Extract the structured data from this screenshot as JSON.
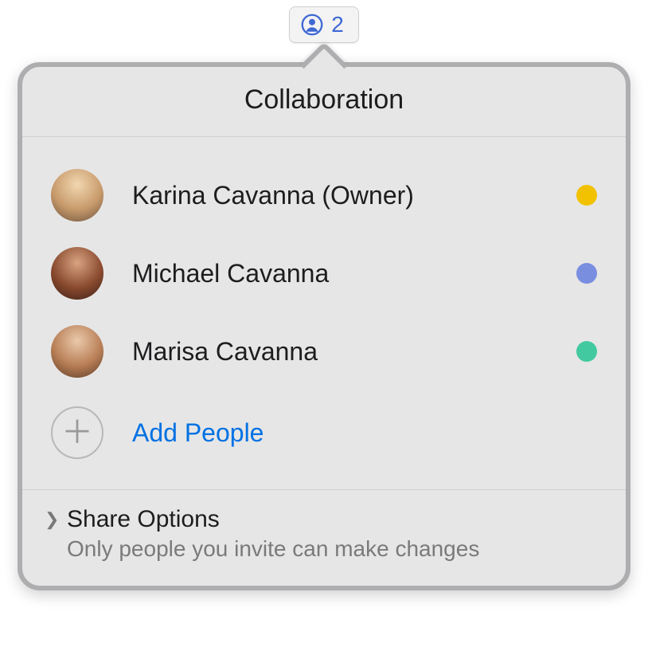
{
  "trigger": {
    "count": "2",
    "icon_color": "#3e68d4"
  },
  "panel": {
    "title": "Collaboration"
  },
  "participants": [
    {
      "name": "Karina Cavanna (Owner)",
      "dot_color": "#f2c200"
    },
    {
      "name": "Michael Cavanna",
      "dot_color": "#7a8ee0"
    },
    {
      "name": "Marisa Cavanna",
      "dot_color": "#43c9a0"
    }
  ],
  "add_people": {
    "label": "Add People"
  },
  "share_options": {
    "title": "Share Options",
    "subtitle": "Only people you invite can make changes"
  }
}
